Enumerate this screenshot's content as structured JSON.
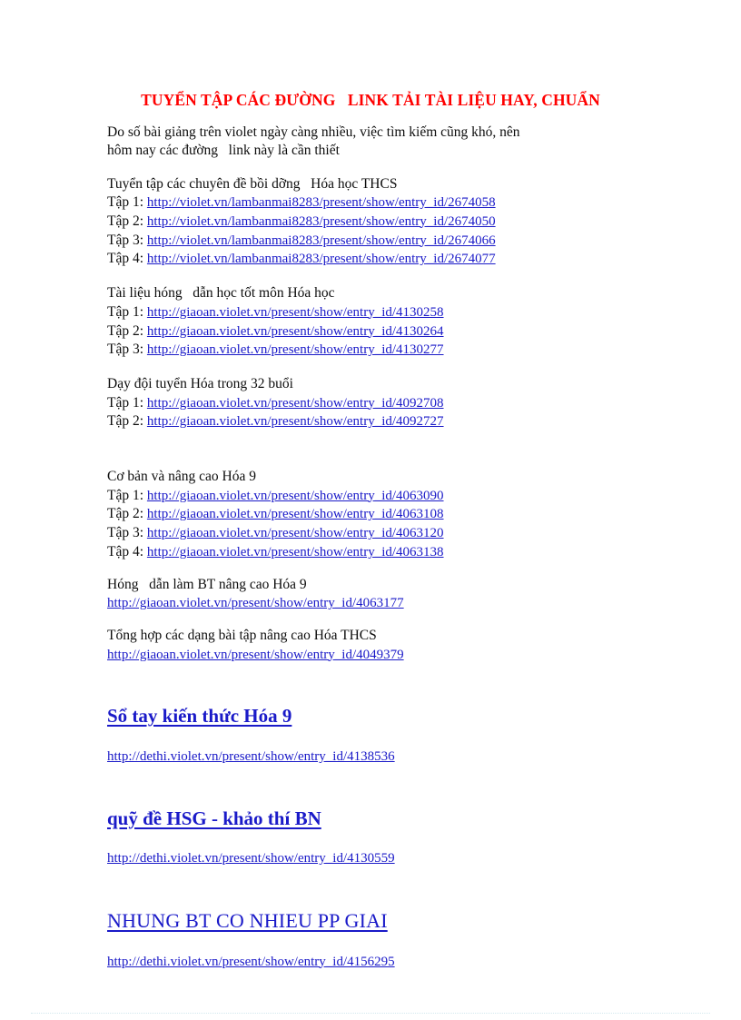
{
  "document": {
    "title": "TUYỂN TẬP CÁC ĐƯỜNG   LINK TẢI TÀI LIỆU HAY, CHUẨN",
    "intro": "Do số bài giảng trên violet ngày càng nhiều, việc tìm kiếm cũng khó, nên\nhôm nay các đường   link này là cần thiết",
    "sections": [
      {
        "heading": "Tuyển tập các chuyên đề bồi dỡng   Hóa học THCS",
        "links": [
          {
            "label": "Tập 1:",
            "url": "http://violet.vn/lambanmai8283/present/show/entry_id/2674058"
          },
          {
            "label": "Tập 2:",
            "url": "http://violet.vn/lambanmai8283/present/show/entry_id/2674050"
          },
          {
            "label": "Tập 3:",
            "url": "http://violet.vn/lambanmai8283/present/show/entry_id/2674066"
          },
          {
            "label": "Tập 4:",
            "url": "http://violet.vn/lambanmai8283/present/show/entry_id/2674077"
          }
        ]
      },
      {
        "heading": "Tài liệu hóng   dẫn học tốt môn Hóa học",
        "links": [
          {
            "label": "Tập 1:",
            "url": "http://giaoan.violet.vn/present/show/entry_id/4130258"
          },
          {
            "label": "Tập 2:",
            "url": "http://giaoan.violet.vn/present/show/entry_id/4130264"
          },
          {
            "label": "Tập 3:",
            "url": "http://giaoan.violet.vn/present/show/entry_id/4130277"
          }
        ]
      },
      {
        "heading": "Dạy đội tuyển Hóa trong 32 buổi",
        "links": [
          {
            "label": "Tập 1:",
            "url": "http://giaoan.violet.vn/present/show/entry_id/4092708"
          },
          {
            "label": "Tập 2:",
            "url": "http://giaoan.violet.vn/present/show/entry_id/4092727"
          }
        ]
      },
      {
        "heading": "Cơ bản và nâng cao Hóa 9",
        "links": [
          {
            "label": "Tập 1:",
            "url": "http://giaoan.violet.vn/present/show/entry_id/4063090"
          },
          {
            "label": "Tập 2:",
            "url": "http://giaoan.violet.vn/present/show/entry_id/4063108"
          },
          {
            "label": "Tập 3:",
            "url": "http://giaoan.violet.vn/present/show/entry_id/4063120"
          },
          {
            "label": "Tập 4:",
            "url": "http://giaoan.violet.vn/present/show/entry_id/4063138"
          }
        ]
      },
      {
        "heading": "Hóng   dẫn làm BT nâng cao Hóa 9",
        "single_url": "http://giaoan.violet.vn/present/show/entry_id/4063177"
      },
      {
        "heading": "Tổng hợp các dạng bài tập nâng cao Hóa THCS",
        "single_url": "http://giaoan.violet.vn/present/show/entry_id/4049379"
      }
    ],
    "featured": [
      {
        "heading": "Sổ tay kiến thức Hóa 9",
        "bold": true,
        "url": "http://dethi.violet.vn/present/show/entry_id/4138536"
      },
      {
        "heading": "quỹ đề HSG - khảo thí BN",
        "bold": true,
        "url": "http://dethi.violet.vn/present/show/entry_id/4130559"
      },
      {
        "heading": "NHUNG BT CO NHIEU PP GIAI",
        "bold": false,
        "url": "http://dethi.violet.vn/present/show/entry_id/4156295"
      }
    ],
    "colors": {
      "title_red": "#ff0000",
      "link_blue": "#1a1ac8",
      "body_black": "#0d0d0d",
      "rule_tint": "#cfe6ee"
    }
  }
}
